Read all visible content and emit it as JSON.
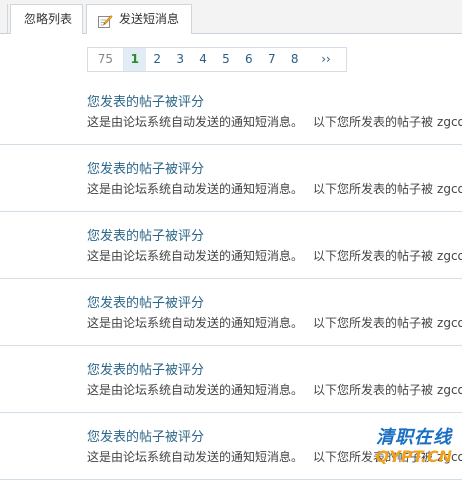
{
  "tabs": {
    "ignore_label": "忽略列表",
    "send_label": "发送短消息"
  },
  "pagination": {
    "first": "75",
    "current": "1",
    "pages": [
      "2",
      "3",
      "4",
      "5",
      "6",
      "7",
      "8"
    ],
    "next": "››"
  },
  "messages": [
    {
      "title": "您发表的帖子被评分",
      "snippet": "这是由论坛系统自动发送的通知短消息。",
      "snippet2": "以下您所发表的帖子被",
      "user": "zgcol"
    },
    {
      "title": "您发表的帖子被评分",
      "snippet": "这是由论坛系统自动发送的通知短消息。",
      "snippet2": "以下您所发表的帖子被",
      "user": "zgcol"
    },
    {
      "title": "您发表的帖子被评分",
      "snippet": "这是由论坛系统自动发送的通知短消息。",
      "snippet2": "以下您所发表的帖子被",
      "user": "zgcol"
    },
    {
      "title": "您发表的帖子被评分",
      "snippet": "这是由论坛系统自动发送的通知短消息。",
      "snippet2": "以下您所发表的帖子被",
      "user": "zgcol"
    },
    {
      "title": "您发表的帖子被评分",
      "snippet": "这是由论坛系统自动发送的通知短消息。",
      "snippet2": "以下您所发表的帖子被",
      "user": "zgcol"
    },
    {
      "title": "您发表的帖子被评分",
      "snippet": "这是由论坛系统自动发送的通知短消息。",
      "snippet2": "以下您所发表的帖子被",
      "user": "zgcol"
    }
  ],
  "watermark": {
    "line1": "清职在线",
    "line2": "QYPT.CN"
  },
  "colors": {
    "title_link": "#2b6688",
    "page_current": "#2a8a2a",
    "divider": "#d2dee8"
  }
}
